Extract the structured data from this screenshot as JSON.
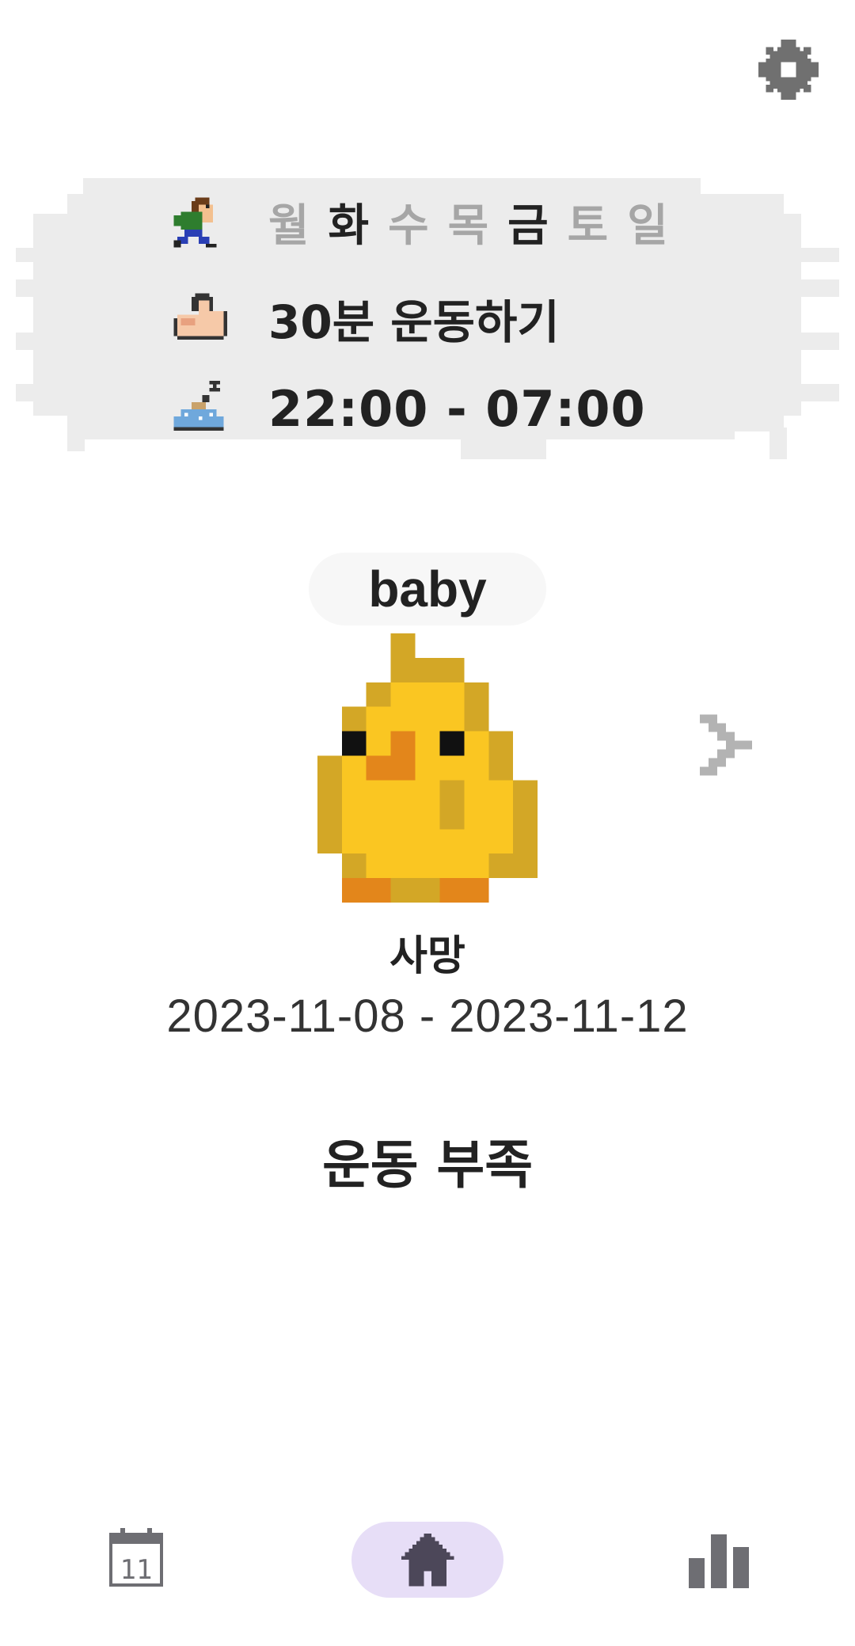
{
  "header": {
    "settings_icon": "gear-icon"
  },
  "schedule": {
    "days": [
      {
        "label": "월",
        "active": false
      },
      {
        "label": "화",
        "active": true
      },
      {
        "label": "수",
        "active": false
      },
      {
        "label": "목",
        "active": false
      },
      {
        "label": "금",
        "active": true
      },
      {
        "label": "토",
        "active": false
      },
      {
        "label": "일",
        "active": false
      }
    ],
    "goal_text": "30분 운동하기",
    "sleep_text": "22:00 - 07:00",
    "icons": [
      "running-man-icon",
      "flexed-arm-icon",
      "sleeping-icon"
    ]
  },
  "pet": {
    "stage_label": "baby",
    "status_name": "사망",
    "date_range": "2023-11-08 - 2023-11-12",
    "reason": "운동 부족"
  },
  "nav": {
    "items": [
      "calendar-icon",
      "home-icon",
      "bar-chart-icon"
    ],
    "calendar_day": "11",
    "active": "home-icon",
    "active_color": "#e7def7"
  },
  "colors": {
    "panel": "#ececec",
    "inactive_day": "#a6a6a6",
    "chick_body": "#fac622",
    "chick_shade": "#d3a726",
    "chick_orange": "#e3861b"
  }
}
